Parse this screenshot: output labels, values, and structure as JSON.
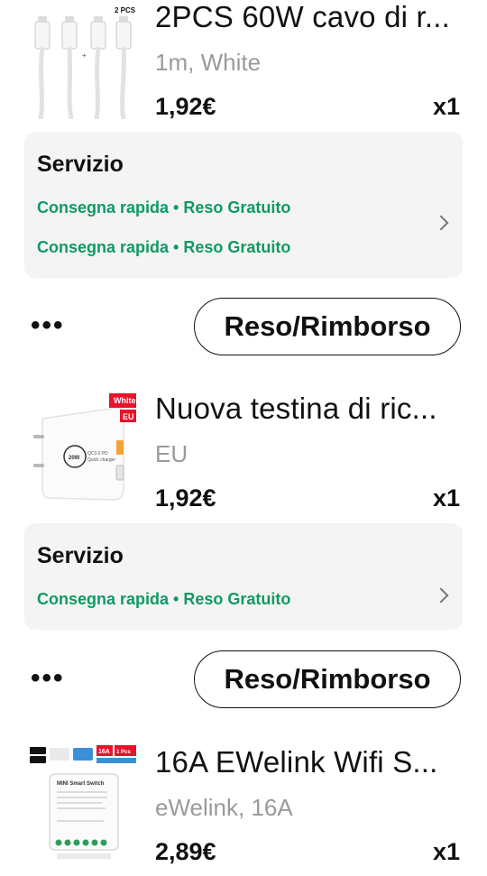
{
  "items": [
    {
      "title": "2PCS 60W cavo di r...",
      "variant": "1m, White",
      "price": "1,92€",
      "qty": "x1",
      "thumb_badge": "2 PCS"
    },
    {
      "title": "Nuova testina di ric...",
      "variant": "EU",
      "price": "1,92€",
      "qty": "x1",
      "thumb_badge_top": "White",
      "thumb_badge_bottom": "EU"
    },
    {
      "title": "16A EWelink Wifi S...",
      "variant": "eWelink, 16A",
      "price": "2,89€",
      "qty": "x1",
      "thumb_badge": "16A",
      "thumb_badge2": "1 Pcs",
      "thumb_label": "MINI Smart Switch"
    }
  ],
  "services": [
    {
      "title": "Servizio",
      "lines": [
        "Consegna rapida • Reso Gratuito",
        "Consegna rapida • Reso Gratuito"
      ]
    },
    {
      "title": "Servizio",
      "lines": [
        "Consegna rapida • Reso Gratuito"
      ]
    }
  ],
  "actions": {
    "more_label": "•••",
    "refund_label": "Reso/Rimborso"
  },
  "colors": {
    "accent_green": "#0f9a63",
    "service_bg": "#f4f4f4",
    "muted_text": "#9a9a9a"
  }
}
